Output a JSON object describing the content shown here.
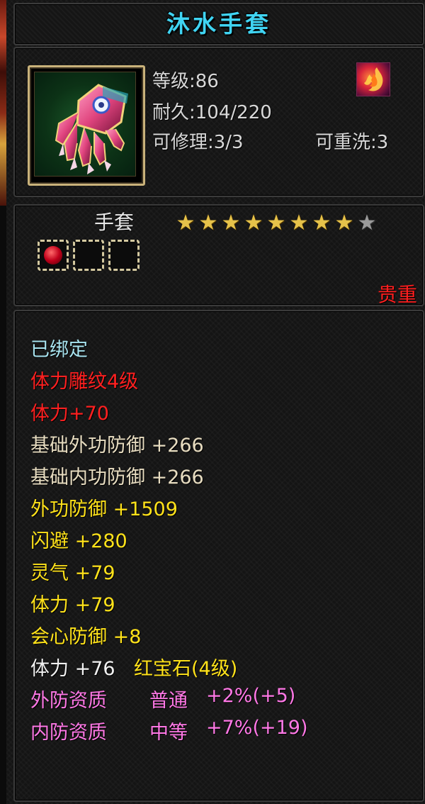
{
  "item": {
    "name": "沐水手套",
    "icon": "pink-gauntlet-icon",
    "level": "等级:86",
    "durability": "耐久:104/220",
    "repairable": "可修理:3/3",
    "rewashable": "可重洗:3",
    "badge_icon": "flame-badge-icon"
  },
  "type": {
    "label": "手套",
    "stars_filled": 8,
    "stars_total": 9,
    "slots": [
      {
        "icon": "red-gem-icon",
        "filled": true
      },
      {
        "icon": "empty-slot",
        "filled": false
      },
      {
        "icon": "empty-slot",
        "filled": false
      }
    ],
    "rarity": "贵重"
  },
  "attributes": {
    "bound": "已绑定",
    "engraving": "体力雕纹4级",
    "engraving_bonus": "体力+70",
    "base_external_defense": "基础外功防御 +266",
    "base_internal_defense": "基础内功防御 +266",
    "external_defense": "外功防御 +1509",
    "dodge": "闪避 +280",
    "spirit": "灵气 +79",
    "stamina": "体力 +79",
    "crit_defense": "会心防御 +8",
    "gem_stat": "体力 +76",
    "gem_name": "红宝石(4级)",
    "ext_quality": "外防资质",
    "ext_quality_grade": "普通",
    "ext_quality_value": "+2%(+5)",
    "int_quality": "内防资质",
    "int_quality_grade": "中等",
    "int_quality_value": "+7%(+19)"
  },
  "colors": {
    "title": "#40d4f2",
    "bound": "#a8e4f0",
    "engraving": "#ff2020",
    "base": "#e7dcc0",
    "bonus": "#ffe21a",
    "gem": "#f2f2f2",
    "quality": "#ff78e6",
    "rarity": "#ff1e1e",
    "star_on": "#e6c24a",
    "star_off": "#9a9a9a"
  }
}
